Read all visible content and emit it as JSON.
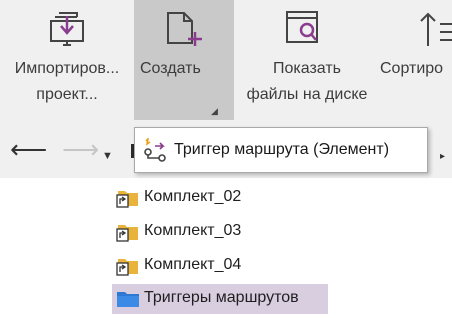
{
  "ribbon": {
    "import": {
      "label_line1": "Импортиров...",
      "label_line2": "проект...",
      "icon": "import-project-icon"
    },
    "create": {
      "label": "Создать",
      "icon": "new-item-icon",
      "dropdown_glyph": "◢"
    },
    "show_files": {
      "label_line1": "Показать",
      "label_line2": "файлы на диске",
      "icon": "show-files-icon"
    },
    "sort": {
      "label": "Сортиро",
      "icon": "sort-icon"
    }
  },
  "nav": {
    "back_glyph": "⟵",
    "forward_glyph": "⟶",
    "history_glyph": "▼",
    "more_glyph": "▸"
  },
  "popup": {
    "item_label": "Триггер маршрута (Элемент)",
    "item_icon": "route-trigger-icon"
  },
  "tree": {
    "items": [
      {
        "label": "Комплект_02",
        "icon": "folder-shortcut-icon"
      },
      {
        "label": "Комплект_03",
        "icon": "folder-shortcut-icon"
      },
      {
        "label": "Комплект_04",
        "icon": "folder-shortcut-icon"
      },
      {
        "label": "Триггеры маршрутов",
        "icon": "blue-folder-icon",
        "selected": true
      }
    ]
  },
  "colors": {
    "ribbon_bg": "#f0f0f0",
    "create_active_bg": "#c9c9c9",
    "accent_purple": "#8a3c8e",
    "selection_bg": "#d9cde0",
    "folder_yellow": "#e8b43c",
    "folder_blue": "#2f78d4"
  }
}
